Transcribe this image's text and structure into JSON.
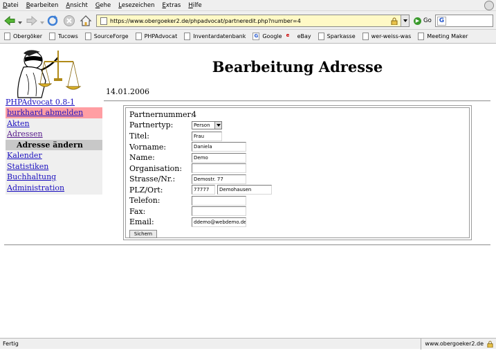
{
  "browser": {
    "menu": [
      {
        "underline": "D",
        "rest": "atei"
      },
      {
        "underline": "B",
        "rest": "earbeiten"
      },
      {
        "underline": "A",
        "rest": "nsicht"
      },
      {
        "underline": "G",
        "rest": "ehe"
      },
      {
        "underline": "L",
        "rest": "esezeichen"
      },
      {
        "underline": "E",
        "rest": "xtras"
      },
      {
        "underline": "H",
        "rest": "ilfe"
      }
    ],
    "url": "https://www.obergoeker2.de/phpadvocat/partneredit.php?number=4",
    "go_label": "Go",
    "search_engine_icon": "google-icon",
    "bookmarks": [
      {
        "label": "Obergöker",
        "icon": "page-icon"
      },
      {
        "label": "Tucows",
        "icon": "page-icon"
      },
      {
        "label": "SourceForge",
        "icon": "page-icon"
      },
      {
        "label": "PHPAdvocat",
        "icon": "page-icon"
      },
      {
        "label": "Inventardatenbank",
        "icon": "page-icon"
      },
      {
        "label": "Google",
        "icon": "google-icon"
      },
      {
        "label": "eBay",
        "icon": "ebay-icon"
      },
      {
        "label": "Sparkasse",
        "icon": "page-icon"
      },
      {
        "label": "wer-weiss-was",
        "icon": "page-icon"
      },
      {
        "label": "Meeting Maker",
        "icon": "page-icon"
      }
    ],
    "status": "Fertig",
    "status_host": "www.obergoeker2.de",
    "colors": {
      "url_bar_bg": "#fff9c6",
      "chrome_bg": "#efefef"
    }
  },
  "app": {
    "version_link": "PHPAdvocat 0.8-1",
    "logo_icon": "justitia-logo",
    "page_title": "Bearbeitung Adresse",
    "date": "14.01.2006",
    "nav": {
      "logout": "burkhard abmelden",
      "akten": "Akten",
      "adressen": "Adressen",
      "active": "Adresse ändern",
      "kalender": "Kalender",
      "statistiken": "Statistiken",
      "buchhaltung": "Buchhaltung",
      "administration": "Administration"
    },
    "colors": {
      "logout_bg": "#ff9ea3",
      "active_bg": "#c8c8c8",
      "link": "#1a0fbf"
    }
  },
  "form": {
    "partnernummer_label": "Partnernummer:",
    "partnernummer_value": "4",
    "partnertyp_label": "Partnertyp:",
    "partnertyp_value": "Person",
    "titel_label": "Titel:",
    "titel_value": "Frau",
    "vorname_label": "Vorname:",
    "vorname_value": "Daniela",
    "name_label": "Name:",
    "name_value": "Demo",
    "organisation_label": "Organisation:",
    "organisation_value": "",
    "strasse_label": "Strasse/Nr.:",
    "strasse_value": "Demostr. 77",
    "plzort_label": "PLZ/Ort:",
    "plz_value": "77777",
    "ort_value": "Demohausen",
    "telefon_label": "Telefon:",
    "telefon_value": "",
    "fax_label": "Fax:",
    "fax_value": "",
    "email_label": "Email:",
    "email_value": "ddemo@webdemo.de",
    "save_label": "Sichern"
  }
}
